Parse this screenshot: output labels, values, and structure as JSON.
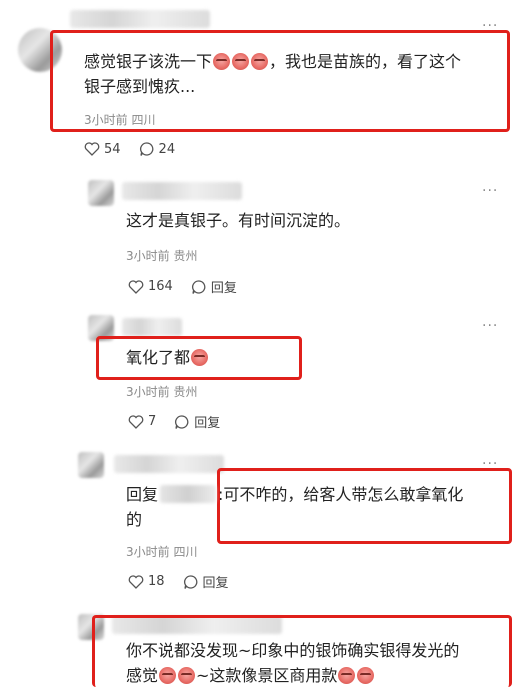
{
  "comments": [
    {
      "text_a": "感觉银子该洗一下",
      "text_b": "，我也是苗族的，看了这个",
      "text_c": "银子感到愧疚...",
      "meta": "3小时前 四川",
      "likes": "54",
      "replies": "24"
    },
    {
      "text": "这才是真银子。有时间沉淀的。",
      "meta": "3小时前 贵州",
      "likes": "164",
      "reply_label": "回复"
    },
    {
      "text": "氧化了都",
      "meta": "3小时前 贵州",
      "likes": "7",
      "reply_label": "回复"
    },
    {
      "reply_prefix": "回复",
      "text_a": ":可不咋的，给客人带怎么敢拿氧化",
      "text_b": "的",
      "meta": "3小时前 四川",
      "likes": "18",
      "reply_label": "回复"
    },
    {
      "text_a": "你不说都没发现~印象中的银饰确实银得发光的",
      "text_b": "感觉",
      "text_c": "~这款像景区商用款"
    }
  ],
  "more_label": "···",
  "colors": {
    "highlight": "#e0201b"
  }
}
